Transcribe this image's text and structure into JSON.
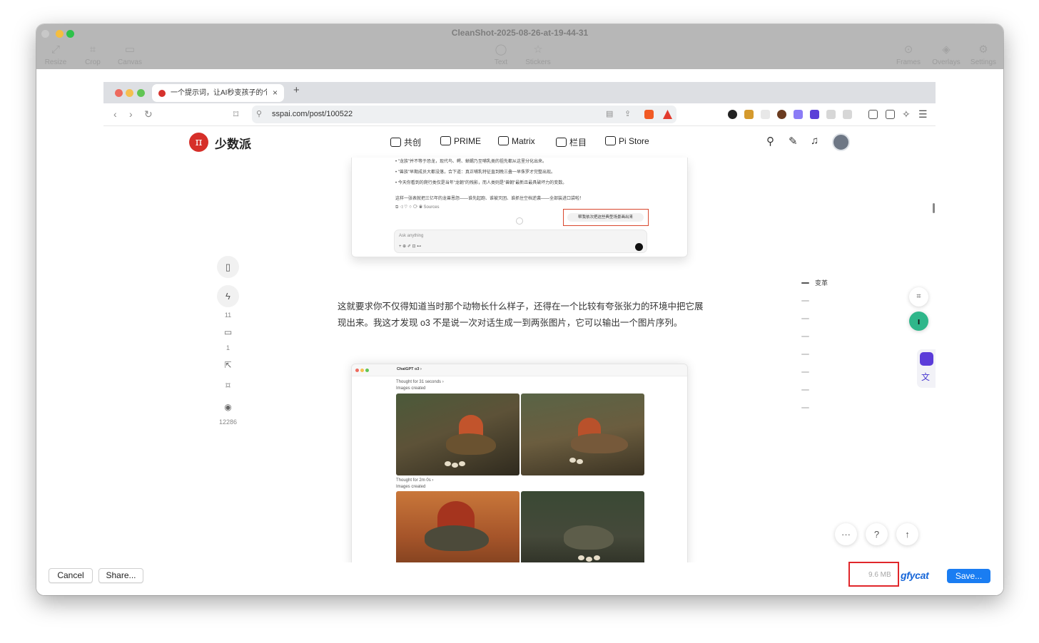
{
  "window": {
    "title": "CleanShot-2025-08-26-at-19-44-31",
    "toolbar_left": [
      {
        "label": "Resize",
        "icon": "resize-icon"
      },
      {
        "label": "Crop",
        "icon": "crop-icon"
      },
      {
        "label": "Canvas",
        "icon": "canvas-icon"
      }
    ],
    "toolbar_center": [
      {
        "label": "Text",
        "icon": "text-bubble-icon"
      },
      {
        "label": "Stickers",
        "icon": "star-icon"
      }
    ],
    "toolbar_right": [
      {
        "label": "Frames",
        "icon": "frames-icon"
      },
      {
        "label": "Overlays",
        "icon": "overlays-icon"
      },
      {
        "label": "Settings",
        "icon": "gear-icon"
      }
    ],
    "bottom": {
      "cancel": "Cancel",
      "share": "Share...",
      "file_size": "9.6 MB",
      "gfycat": "gfycat",
      "save": "Save..."
    }
  },
  "browser": {
    "tab_title": "一个提示词，让AI秒变孩子的个",
    "tab_close": "×",
    "new_tab": "+",
    "url": "sspai.com/post/100522"
  },
  "site": {
    "logo_glyph": "π",
    "logo_text": "少数派",
    "nav": [
      {
        "label": "共创",
        "icon": "community-icon"
      },
      {
        "label": "PRIME",
        "icon": "prime-icon"
      },
      {
        "label": "Matrix",
        "icon": "matrix-icon"
      },
      {
        "label": "栏目",
        "icon": "column-icon"
      },
      {
        "label": "Pi Store",
        "icon": "store-icon"
      }
    ]
  },
  "article": {
    "chat_lines": [
      "• \"龙族\"并不等于恐龙，现代鸟、鳄、蜥蜴乃至哺乳类的祖先都从这里分化出来。",
      "• \"兽族\"早期成员大都没落，合下道：真正哺乳特征直到晚三叠一早侏罗才完整出现。",
      "• 今天你看到的爬行类仅是当年\"龙朝\"的残影，而人类则是\"兽朝\"最新且最具破坏力的变数。",
      "这样一张表就把三亿年的龙兽恩怨——谁先起跑、谁被灭团、谁抓住空档逆袭——全部装进口袋啦！"
    ],
    "chat_sources": "Sources",
    "chat_suggestion": "帮我依次把这些典型场景画出来",
    "chat_placeholder": "Ask anything",
    "paragraph": "这就要求你不仅得知道当时那个动物长什么样子，还得在一个比较有夸张张力的环境中把它展现出来。我这才发现 o3 不是说一次对话生成一到两张图片，它可以输出一个图片序列。",
    "chat2_title": "ChatGPT o3 ›",
    "chat2_thought1": "Thought for 31 seconds ›",
    "chat2_created1": "Images created",
    "chat2_thought2": "Thought for 2m 0s ›",
    "chat2_created2": "Images created"
  },
  "left_rail": {
    "likes": "11",
    "comments": "1",
    "views": "12286"
  },
  "toc": {
    "first": "变革"
  },
  "fabs": {
    "more": "···",
    "help": "?",
    "top": "↑"
  }
}
